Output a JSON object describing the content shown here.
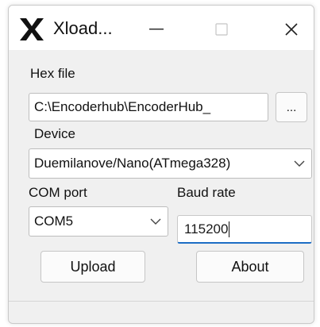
{
  "window": {
    "title": "Xload...",
    "colors": {
      "accent": "#1c6dc4",
      "background": "#f0f0f0"
    }
  },
  "labels": {
    "hex_file": "Hex file",
    "device": "Device",
    "com_port": "COM port",
    "baud_rate": "Baud rate"
  },
  "hex_file": {
    "value": "C:\\Encoderhub\\EncoderHub_",
    "browse_label": "..."
  },
  "device": {
    "selected": "Duemilanove/Nano(ATmega328)"
  },
  "com_port": {
    "selected": "COM5"
  },
  "baud_rate": {
    "value": "115200"
  },
  "buttons": {
    "upload": "Upload",
    "about": "About"
  }
}
